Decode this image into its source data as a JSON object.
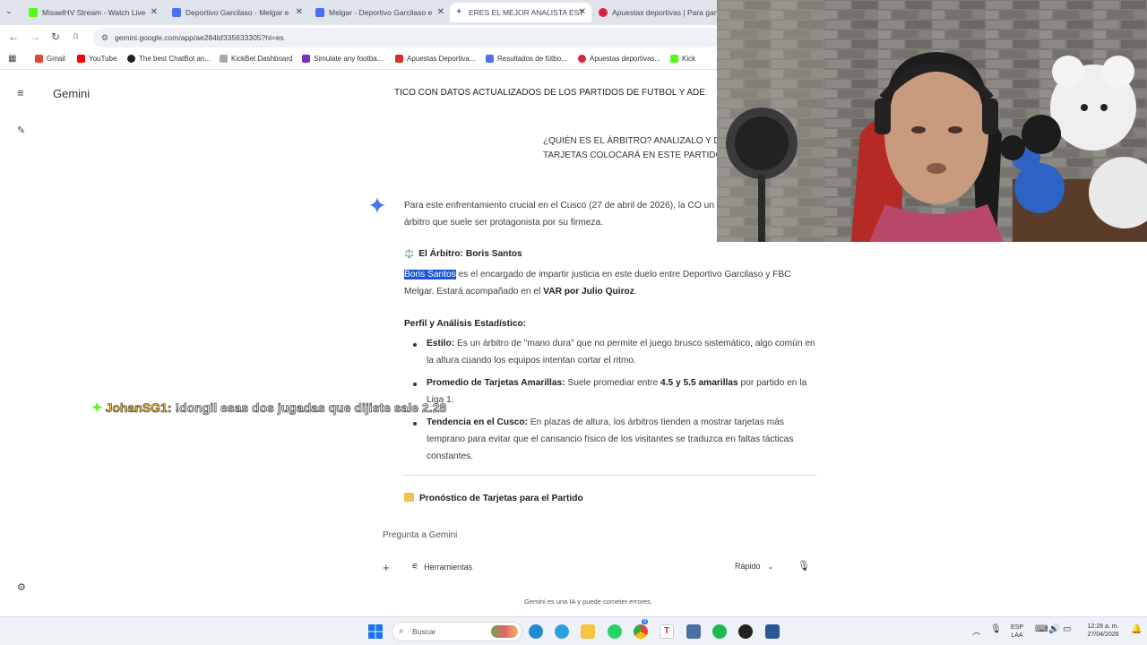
{
  "browser": {
    "tabs": [
      {
        "label": "MisaelHV Stream - Watch Live",
        "color": "#53fc18"
      },
      {
        "label": "Deportivo Garcilaso - Melgar e",
        "color": "#4c6ef5"
      },
      {
        "label": "Melgar - Deportivo Garcilaso e",
        "color": "#4c6ef5"
      },
      {
        "label": "ERES EL MEJOR ANALISTA EST",
        "color": "#4285f4"
      },
      {
        "label": "Apuestas deportivas | Para gan",
        "color": "#d6253f"
      }
    ],
    "url": "gemini.google.com/app/ae284bf335633305?hl=es",
    "bookmarks": [
      {
        "label": "Gmail",
        "color": "#ea4335"
      },
      {
        "label": "YouTube",
        "color": "#ff0000"
      },
      {
        "label": "The best ChatBot an...",
        "color": "#222222"
      },
      {
        "label": "KickBet Dashboard",
        "color": "#aaaaaa"
      },
      {
        "label": "Simulate any footba...",
        "color": "#7b2fbe"
      },
      {
        "label": "Apuestas Deportiva...",
        "color": "#d93025"
      },
      {
        "label": "Resultados de fútbo...",
        "color": "#4c6ef5"
      },
      {
        "label": "Apuestas deportivas...",
        "color": "#d6253f"
      },
      {
        "label": "Kick",
        "color": "#53fc18"
      }
    ]
  },
  "gemini": {
    "brand": "Gemini",
    "top_prompt_line": "TICO CON DATOS ACTUALIZADOS DE LOS PARTIDOS DE FUTBOL Y ADE",
    "user_question": "¿QUIÉN ES EL ÁRBITRO? ANALIZALO Y D TARJETAS COLOCARÁ EN ESTE PARTIDO",
    "intro": "Para este enfrentamiento crucial en el Cusco (27 de abril de 2026), la CO un árbitro que suele ser protagonista por su firmeza.",
    "referee_heading_icon": "⚖️",
    "referee_heading": "El Árbitro: Boris Santos",
    "referee_name": "Boris Santos",
    "referee_text": " es el encargado de impartir justicia en este duelo entre Deportivo Garcilaso y FBC Melgar. Estará acompañado en el ",
    "var_text": "VAR por Julio Quiroz",
    "period": ".",
    "profile_heading": "Perfil y Análisis Estadístico:",
    "bullets": [
      {
        "label": "Estilo:",
        "text": " Es un árbitro de \"mano dura\" que no permite el juego brusco sistemático, algo común en la altura cuando los equipos intentan cortar el ritmo."
      },
      {
        "label": "Promedio de Tarjetas Amarillas:",
        "text_before": " Suele promediar entre ",
        "bold": "4.5 y 5.5 amarillas",
        "text_after": " por partido en la Liga 1."
      },
      {
        "label": "Tendencia en el Cusco:",
        "text": " En plazas de altura, los árbitros tienden a mostrar tarjetas más temprano para evitar que el cansancio físico de los visitantes se traduzca en faltas tácticas constantes."
      }
    ],
    "forecast_heading": "Pronóstico de Tarjetas para el Partido",
    "composer": {
      "placeholder": "Pregunta a Gemini",
      "tools_label": "Herramientas",
      "mode_label": "Rápido"
    },
    "disclaimer": "Gemini es una IA y puede cometer errores."
  },
  "stream_overlay": {
    "username": "JohanSG1:",
    "message": "!dongil esas dos jugadas que dijiste sale 2.28"
  },
  "taskbar": {
    "search_label": "Buscar",
    "language": "ESP",
    "language_sub": "LAA",
    "time": "12:28 a. m.",
    "date": "27/04/2026",
    "badge_count": "8"
  }
}
